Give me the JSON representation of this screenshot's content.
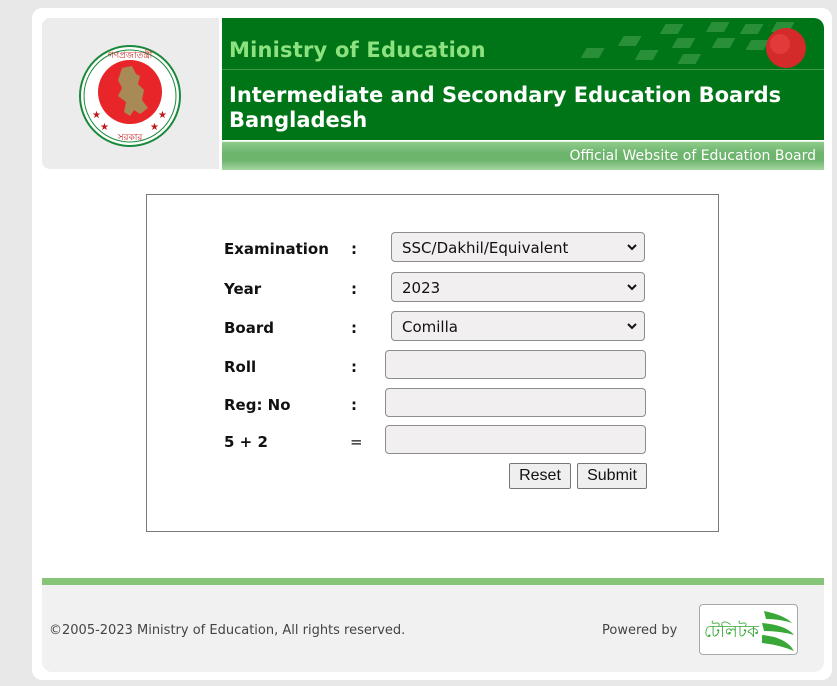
{
  "header": {
    "ministry": "Ministry of Education",
    "title": "Intermediate and Secondary Education Boards Bangladesh",
    "subtitle": "Official Website of Education Board",
    "logo": "bangladesh-government-seal-icon"
  },
  "form": {
    "fields": [
      {
        "label": "Examination",
        "separator": ":",
        "type": "select",
        "value": "SSC/Dakhil/Equivalent"
      },
      {
        "label": "Year",
        "separator": ":",
        "type": "select",
        "value": "2023"
      },
      {
        "label": "Board",
        "separator": ":",
        "type": "select",
        "value": "Comilla"
      },
      {
        "label": "Roll",
        "separator": ":",
        "type": "text",
        "value": ""
      },
      {
        "label": "Reg: No",
        "separator": ":",
        "type": "text",
        "value": ""
      },
      {
        "label": "5 + 2",
        "separator": "=",
        "type": "text",
        "value": ""
      }
    ],
    "reset_label": "Reset",
    "submit_label": "Submit"
  },
  "footer": {
    "copyright": "©2005-2023 Ministry of Education, All rights reserved.",
    "powered_by": "Powered by",
    "sponsor_logo": "teletalk-logo",
    "sponsor_text": "টেলিটক"
  },
  "colors": {
    "banner_green": "#007517",
    "ministry_text": "#8de27f",
    "footer_line": "#86c478"
  }
}
